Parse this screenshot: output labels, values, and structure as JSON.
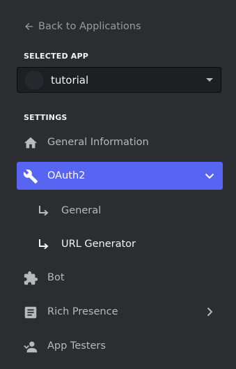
{
  "back_link": {
    "label": "Back to Applications",
    "icon": "arrow-left-icon"
  },
  "selected_app": {
    "header": "SELECTED APP",
    "name": "tutorial"
  },
  "settings": {
    "header": "SETTINGS",
    "items": [
      {
        "label": "General Information",
        "icon": "home-icon"
      },
      {
        "label": "OAuth2",
        "icon": "wrench-icon",
        "active": true,
        "expanded": true,
        "children": [
          {
            "label": "General",
            "icon": "sub-arrow-icon"
          },
          {
            "label": "URL Generator",
            "icon": "sub-arrow-icon",
            "current": true
          }
        ]
      },
      {
        "label": "Bot",
        "icon": "puzzle-icon"
      },
      {
        "label": "Rich Presence",
        "icon": "document-icon",
        "has_submenu": true
      },
      {
        "label": "App Testers",
        "icon": "person-icon"
      }
    ]
  },
  "colors": {
    "background": "#2b2d31",
    "accent": "#5865f2",
    "text_muted": "#b5bac1",
    "text_bright": "#f2f3f5"
  }
}
